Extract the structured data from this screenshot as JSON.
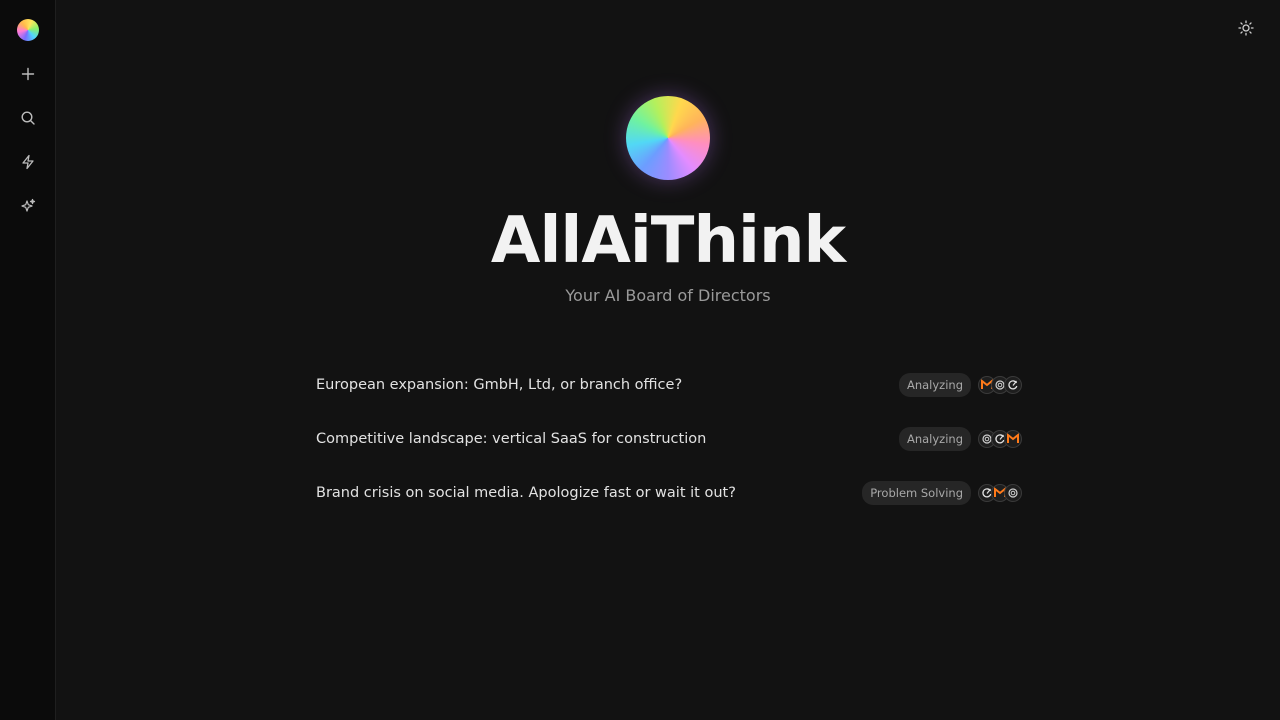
{
  "sidebar": {
    "logo": "allaithink-logo",
    "items": [
      {
        "name": "new-chat",
        "icon": "plus-icon"
      },
      {
        "name": "search",
        "icon": "search-icon"
      },
      {
        "name": "quick",
        "icon": "lightning-icon"
      },
      {
        "name": "discover",
        "icon": "sparkles-icon"
      }
    ]
  },
  "header": {
    "theme_icon": "sun-icon"
  },
  "hero": {
    "title": "AllAiThink",
    "subtitle": "Your AI Board of Directors"
  },
  "suggestions": [
    {
      "text": "European expansion: GmbH, Ltd, or branch office?",
      "badge": "Analyzing",
      "models": [
        "mistral-icon",
        "claude-icon",
        "openai-icon"
      ]
    },
    {
      "text": "Competitive landscape: vertical SaaS for construction",
      "badge": "Analyzing",
      "models": [
        "claude-icon",
        "openai-icon",
        "mistral-icon"
      ]
    },
    {
      "text": "Brand crisis on social media. Apologize fast or wait it out?",
      "badge": "Problem Solving",
      "models": [
        "openai-icon",
        "mistral-icon",
        "claude-icon"
      ]
    }
  ],
  "colors": {
    "background": "#121212",
    "sidebar": "#0b0b0b",
    "badge_bg": "#262626",
    "text": "#e2e2e2"
  }
}
